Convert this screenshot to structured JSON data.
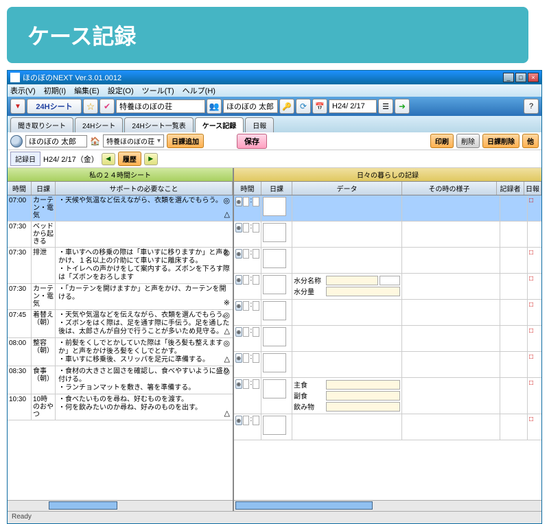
{
  "banner": "ケース記録",
  "window": {
    "title": "ほのぼのNEXT  Ver.3.01.0012",
    "min": "_",
    "max": "□",
    "close": "×"
  },
  "menu": [
    "表示(V)",
    "初期(I)",
    "編集(E)",
    "設定(O)",
    "ツール(T)",
    "ヘルプ(H)"
  ],
  "toolbar1": {
    "sheet_btn": "24Hシート",
    "facility": "特養ほのぼの荘",
    "user": "ほのぼの 太郎",
    "date": "H24/ 2/17"
  },
  "tabs": [
    "聞き取りシート",
    "24Hシート",
    "24Hシート一覧表",
    "ケース記録",
    "日報"
  ],
  "active_tab": 3,
  "toolbar2": {
    "user": "ほのぼの 太郎",
    "facility": "特養ほのぼの荘",
    "add_schedule": "日課追加",
    "save": "保存",
    "print": "印刷",
    "delete": "削除",
    "del_schedule": "日課削除",
    "other": "他"
  },
  "toolbar3": {
    "record_day_label": "記録日",
    "record_day": "H24/ 2/17（金）",
    "history": "履歴"
  },
  "left": {
    "title": "私の２４時間シート",
    "headers": {
      "time": "時間",
      "task": "日課",
      "support": "サポートの必要なこと"
    },
    "rows": [
      {
        "time": "07:00",
        "task": "カーテン・電気",
        "text": "・天候や気温など伝えながら、衣類を選んでもらう。",
        "mark_top": "◎",
        "mark_bot": "△",
        "sel": true
      },
      {
        "time": "07:30",
        "task": "ベッドから起きる",
        "text": "",
        "mark_top": "",
        "mark_bot": ""
      },
      {
        "time": "07:30",
        "task": "排泄",
        "text": "・車いすへの移乗の際は「車いすに移りますか」と声をかけ、１名以上の介助にて車いすに離床する。\n・トイレへの声かけをして案内する。ズボンを下ろす際は「ズボンをおろします",
        "mark_top": "◎",
        "mark_bot": ""
      },
      {
        "time": "07:30",
        "task": "カーテン・電気",
        "text": "・「カーテンを開けますか」と声をかけ、カーテンを開ける。",
        "mark_top": "",
        "mark_bot": "※"
      },
      {
        "time": "07:45",
        "task": "着替え（朝）",
        "text": "・天気や気温などを伝えながら、衣類を選んでもらう。\n・ズボンをはく際は、足を通す際に手伝う。足を通した後は、太郎さんが自分で行うことが多いため見守る。",
        "mark_top": "◎",
        "mark_bot": "△"
      },
      {
        "time": "08:00",
        "task": "整容（朝）",
        "text": "・前髪をくしでとかしていた際は「後ろ髪も整えますか」と声をかけ後ろ髪をくしでとかす。\n・車いすに移乗後、スリッパを足元に準備する。",
        "mark_top": "◎",
        "mark_bot": "△"
      },
      {
        "time": "08:30",
        "task": "食事（朝）",
        "text": "・食材の大きさと固さを確認し、食べやすいように盛り付ける。\n・ランチョンマットを敷き、箸を準備する。",
        "mark_top": "◎",
        "mark_bot": ""
      },
      {
        "time": "10:30",
        "task": "10時のおやつ",
        "text": "・食べたいものを尋ね、好むものを渡す。\n・何を飲みたいのか尋ね、好みのものを出す。",
        "mark_top": "",
        "mark_bot": "△"
      }
    ]
  },
  "right": {
    "title": "日々の暮らしの記録",
    "headers": {
      "time": "時間",
      "task": "日課",
      "data": "データ",
      "state": "その時の様子",
      "recorder": "記録者",
      "report": "日報"
    },
    "rows": [
      {
        "sel": true,
        "rep": "□",
        "fields": []
      },
      {
        "rep": "",
        "fields": []
      },
      {
        "rep": "□",
        "fields": []
      },
      {
        "rep": "□",
        "fields": [
          {
            "label": "水分名称",
            "unit": true
          },
          {
            "label": "水分量",
            "unit": false
          }
        ]
      },
      {
        "rep": "□",
        "fields": []
      },
      {
        "rep": "□",
        "fields": []
      },
      {
        "rep": "□",
        "fields": []
      },
      {
        "rep": "□",
        "fields": [
          {
            "label": "主食"
          },
          {
            "label": "副食"
          },
          {
            "label": "飲み物"
          }
        ]
      },
      {
        "rep": "□",
        "fields": []
      }
    ]
  },
  "status": "Ready"
}
